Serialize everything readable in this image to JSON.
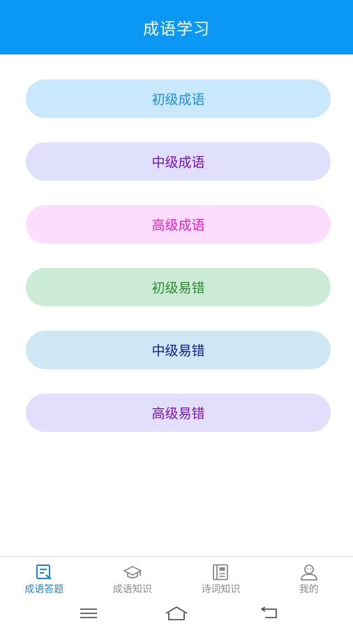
{
  "header": {
    "title": "成语学习"
  },
  "menu": {
    "items": [
      {
        "label": "初级成语"
      },
      {
        "label": "中级成语"
      },
      {
        "label": "高级成语"
      },
      {
        "label": "初级易错"
      },
      {
        "label": "中级易错"
      },
      {
        "label": "高级易错"
      }
    ]
  },
  "tabs": {
    "items": [
      {
        "label": "成语答题",
        "icon": "quiz-icon",
        "active": true
      },
      {
        "label": "成语知识",
        "icon": "graduation-cap-icon"
      },
      {
        "label": "诗词知识",
        "icon": "book-icon"
      },
      {
        "label": "我的",
        "icon": "user-icon"
      }
    ],
    "active_color": "#1a86d4",
    "inactive_color": "#8a8a8a"
  },
  "colors": {
    "header_bg": "#0b97f4"
  }
}
